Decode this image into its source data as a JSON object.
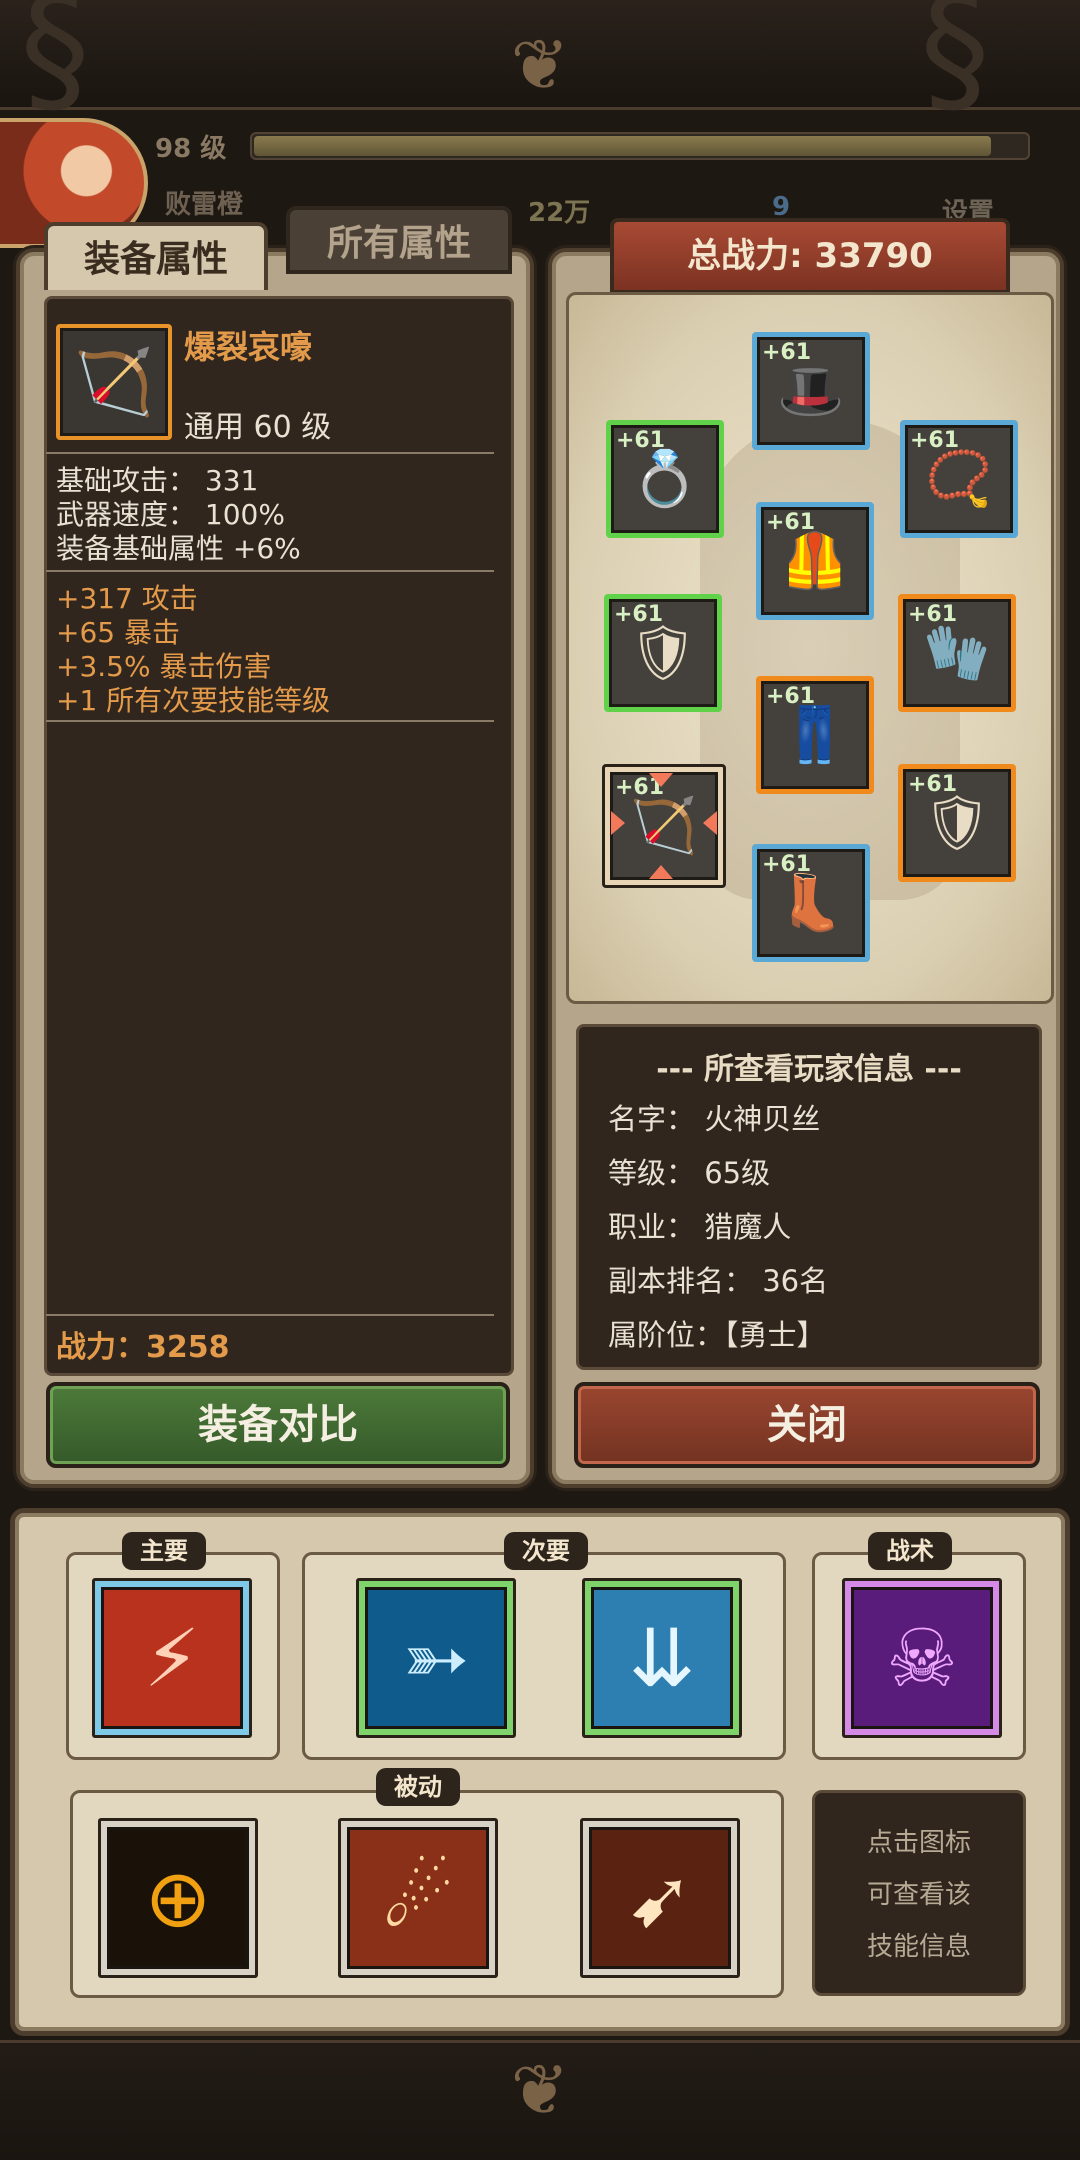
{
  "header": {
    "level": "98 级",
    "player_name": "败雷橙",
    "gold": "22万",
    "gems": "9",
    "settings_label": "设置"
  },
  "tabs": {
    "equip_attr": "装备属性",
    "all_attr": "所有属性"
  },
  "item": {
    "name": "爆裂哀嚎",
    "type_level": "通用 60 级",
    "icon": "bow-icon",
    "base_stats": [
      "基础攻击：  331",
      "武器速度：  100%",
      "装备基础属性 +6%"
    ],
    "bonuses": [
      "+317 攻击",
      "+65 暴击",
      "+3.5% 暴击伤害",
      "+1 所有次要技能等级"
    ],
    "power": "战力：3258"
  },
  "buttons": {
    "compare": "装备对比",
    "close": "关闭"
  },
  "total_power": "总战力: 33790",
  "equipment": [
    {
      "slot": "hat",
      "icon": "hat-icon",
      "glyph": "🎩",
      "level": "+61",
      "quality": "blue"
    },
    {
      "slot": "ring",
      "icon": "ring-icon",
      "glyph": "💍",
      "level": "+61",
      "quality": "green"
    },
    {
      "slot": "necklace",
      "icon": "necklace-icon",
      "glyph": "📿",
      "level": "+61",
      "quality": "blue"
    },
    {
      "slot": "armor",
      "icon": "armor-icon",
      "glyph": "🦺",
      "level": "+61",
      "quality": "blue"
    },
    {
      "slot": "shoulder",
      "icon": "shoulder-icon",
      "glyph": "🛡",
      "level": "+61",
      "quality": "green"
    },
    {
      "slot": "gloves",
      "icon": "gloves-icon",
      "glyph": "🧤",
      "level": "+61",
      "quality": "orange"
    },
    {
      "slot": "pants",
      "icon": "pants-icon",
      "glyph": "👖",
      "level": "+61",
      "quality": "orange"
    },
    {
      "slot": "bow",
      "icon": "bow-icon",
      "glyph": "🏹",
      "level": "+61",
      "quality": "selected"
    },
    {
      "slot": "shield",
      "icon": "shield-icon",
      "glyph": "🛡",
      "level": "+61",
      "quality": "orange"
    },
    {
      "slot": "boots",
      "icon": "boots-icon",
      "glyph": "👢",
      "level": "+61",
      "quality": "blue"
    }
  ],
  "player_info": {
    "title": "--- 所查看玩家信息 ---",
    "lines": [
      "名字：  火神贝丝",
      "等级：  65级",
      "职业：  猎魔人",
      "副本排名：  36名",
      "属阶位：【勇士】"
    ]
  },
  "skills": {
    "primary_label": "主要",
    "secondary_label": "次要",
    "tactic_label": "战术",
    "passive_label": "被动",
    "hint": [
      "点击图标",
      "可查看该",
      "技能信息"
    ],
    "primary": [
      {
        "icon": "red-slash-skill-icon",
        "glyph": "⚡",
        "color": "#b8321e",
        "frame": "#7ec9e8"
      }
    ],
    "secondary": [
      {
        "icon": "multi-arrow-skill-icon",
        "glyph": "➳",
        "color": "#0f5c8c",
        "frame": "#7ed36a"
      },
      {
        "icon": "arrow-rain-skill-icon",
        "glyph": "⇊",
        "color": "#2c7fb0",
        "frame": "#7ed36a"
      }
    ],
    "tactic": [
      {
        "icon": "demon-mark-skill-icon",
        "glyph": "☠",
        "color": "#5a1c7a",
        "frame": "#d68ae8"
      }
    ],
    "passive": [
      {
        "icon": "crosshair-skill-icon",
        "glyph": "⊕",
        "color": "#1a1208",
        "frame": "#d8d2c6"
      },
      {
        "icon": "fire-meteor-skill-icon",
        "glyph": "☄",
        "color": "#8a3018",
        "frame": "#d8d2c6"
      },
      {
        "icon": "piercing-arrow-skill-icon",
        "glyph": "➹",
        "color": "#5a2210",
        "frame": "#d8d2c6"
      }
    ]
  }
}
